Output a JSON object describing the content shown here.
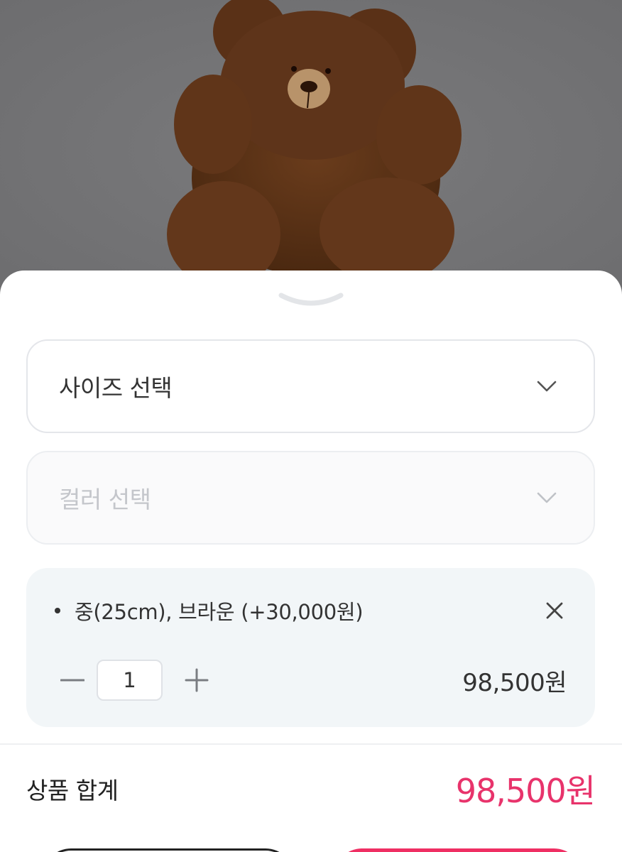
{
  "hero": {
    "image": "brown-teddy-bear-plush"
  },
  "sheet": {
    "collapse_icon": "chevron-down-icon",
    "size_select": {
      "placeholder": "사이즈 선택",
      "icon": "chevron-down-icon"
    },
    "color_select": {
      "placeholder": "컬러 선택",
      "icon": "chevron-down-icon",
      "disabled": true
    },
    "selected_option": {
      "name": "중(25cm), 브라운 (+30,000원)",
      "quantity": "1",
      "price": "98,500원"
    },
    "total": {
      "label": "상품 합계",
      "price": "98,500원"
    }
  },
  "colors": {
    "accent": "#ef2f63",
    "total_price": "#e8336b",
    "option_card_bg": "#f2f6f8"
  }
}
